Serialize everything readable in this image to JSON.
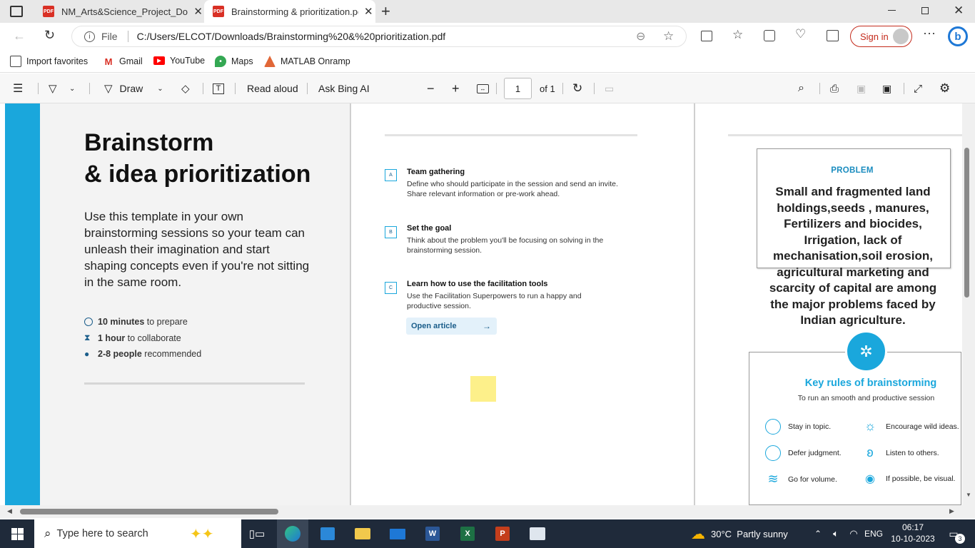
{
  "tabs": [
    {
      "label": "NM_Arts&Science_Project_Docume",
      "icon": "pdf-icon"
    },
    {
      "label": "Brainstorming & prioritization.pdf",
      "icon": "pdf-icon"
    }
  ],
  "address": {
    "label": "File",
    "url": "C:/Users/ELCOT/Downloads/Brainstorming%20&%20prioritization.pdf"
  },
  "account": {
    "sign_in": "Sign in"
  },
  "favorites": [
    {
      "label": "Import favorites",
      "icon": "import-icon"
    },
    {
      "label": "Gmail",
      "icon": "gmail-icon"
    },
    {
      "label": "YouTube",
      "icon": "youtube-icon"
    },
    {
      "label": "Maps",
      "icon": "maps-icon"
    },
    {
      "label": "MATLAB Onramp",
      "icon": "matlab-icon"
    }
  ],
  "pdf_toolbar": {
    "draw": "Draw",
    "read_aloud": "Read aloud",
    "ask_ai": "Ask Bing AI",
    "page": "1",
    "of": "of 1"
  },
  "doc": {
    "title_line1": "Brainstorm",
    "title_line2": "& idea prioritization",
    "intro": "Use this template in your own brainstorming sessions so your team can unleash their imagination and start shaping concepts even if you're not sitting in the same room.",
    "meta": [
      {
        "bold": "10 minutes",
        "rest": " to prepare",
        "icon": "clock-icon"
      },
      {
        "bold": "1 hour",
        "rest": " to collaborate",
        "icon": "hourglass-icon"
      },
      {
        "bold": "2-8 people",
        "rest": " recommended",
        "icon": "person-icon"
      }
    ],
    "steps": [
      {
        "letter": "A",
        "title": "Team gathering",
        "body": "Define who should participate in the session and send an invite. Share relevant information or pre-work ahead."
      },
      {
        "letter": "B",
        "title": "Set the goal",
        "body": "Think about the problem you'll be focusing on solving in the brainstorming session."
      },
      {
        "letter": "C",
        "title": "Learn how to use the facilitation tools",
        "body": "Use the Facilitation Superpowers to run a happy and productive session."
      }
    ],
    "open_article": "Open article",
    "problem_label": "PROBLEM",
    "problem_text": "Small and fragmented land holdings,seeds , manures, Fertilizers and biocides, Irrigation, lack of mechanisation,soil erosion, agricultural marketing and scarcity of capital are among the major problems faced by Indian agriculture.",
    "rules_title": "Key rules of brainstorming",
    "rules_subtitle": "To run an smooth and productive session",
    "rules": [
      {
        "label": "Stay in topic.",
        "icon": "target-icon"
      },
      {
        "label": "Encourage wild ideas.",
        "icon": "lightbulb-icon"
      },
      {
        "label": "Defer judgment.",
        "icon": "face-icon"
      },
      {
        "label": "Listen to others.",
        "icon": "ear-icon"
      },
      {
        "label": "Go for volume.",
        "icon": "stack-icon"
      },
      {
        "label": "If possible, be visual.",
        "icon": "eye-icon"
      }
    ]
  },
  "taskbar": {
    "search_placeholder": "Type here to search",
    "weather": "30°C  Partly sunny",
    "lang": "ENG",
    "time": "06:17",
    "date": "10-10-2023",
    "notifications": "3"
  },
  "colors": {
    "accent_blue": "#1aa7dc",
    "sticky_yellow": "#fdf08a",
    "doc_grey": "#f3f3f3",
    "signin_red": "#c42b1c"
  }
}
